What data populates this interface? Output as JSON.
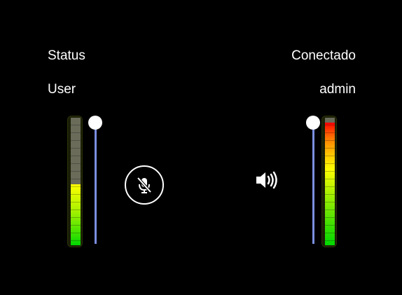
{
  "info": {
    "status_label": "Status",
    "status_value": "Conectado",
    "user_label": "User",
    "user_value": "admin"
  },
  "input": {
    "mic_icon": "mic-muted-icon",
    "mic_muted": true,
    "level_fraction": 0.48,
    "gain_fraction": 1.0
  },
  "output": {
    "speaker_icon": "speaker-volume-icon",
    "level_fraction": 0.96,
    "volume_fraction": 1.0
  },
  "colors": {
    "background": "#000000",
    "text": "#ffffff",
    "slider_track": "#7b8fe0",
    "slider_thumb": "#ffffff",
    "meter_empty": "#6b6b5a",
    "meter_low": "#00d800",
    "meter_mid": "#ffff00",
    "meter_high": "#ff0000"
  }
}
